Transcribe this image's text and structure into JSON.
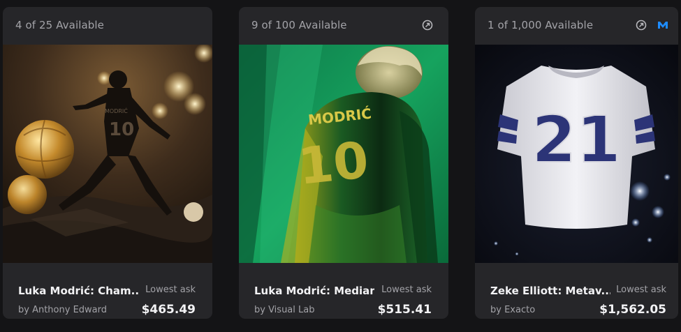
{
  "cards": [
    {
      "availability": "4 of 25 Available",
      "title": "Luka Modrić: Cham...",
      "creator": "by Anthony Edward",
      "ask_label": "Lowest ask",
      "price": "$465.49",
      "jersey_name": "MODRIĆ",
      "jersey_number": "10",
      "icons": []
    },
    {
      "availability": "9 of 100 Available",
      "title": "Luka Modrić: Median",
      "creator": "by Visual Lab",
      "ask_label": "Lowest ask",
      "price": "$515.41",
      "jersey_name": "MODRIĆ",
      "jersey_number": "10",
      "icons": [
        "edition-icon"
      ]
    },
    {
      "availability": "1 of 1,000 Available",
      "title": "Zeke Elliott: Metav...",
      "creator": "by Exacto",
      "ask_label": "Lowest ask",
      "price": "$1,562.05",
      "jersey_number": "21",
      "icons": [
        "edition-icon",
        "meta-icon"
      ]
    }
  ],
  "colors": {
    "card_bg": "#262629",
    "page_bg": "#141416",
    "text_primary": "#f2f2f4",
    "text_secondary": "#a3a3a8",
    "meta_blue": "#1e8cff"
  }
}
